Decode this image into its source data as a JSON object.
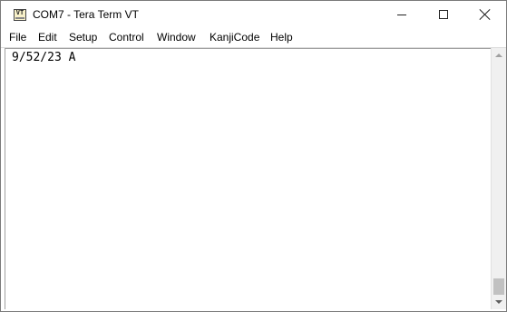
{
  "window": {
    "title": "COM7 - Tera Term VT",
    "icon_text": "VT",
    "icon": "teraterm-app-icon"
  },
  "controls": {
    "minimize_icon": "minimize-icon",
    "maximize_icon": "maximize-icon",
    "close_icon": "close-icon"
  },
  "menu": {
    "items": [
      "File",
      "Edit",
      "Setup",
      "Control",
      "Window",
      "KanjiCode",
      "Help"
    ]
  },
  "terminal": {
    "lines": [
      "9/52/23 A"
    ]
  },
  "scrollbar": {
    "up_icon": "scroll-up-arrow-icon",
    "down_icon": "scroll-down-arrow-icon"
  }
}
